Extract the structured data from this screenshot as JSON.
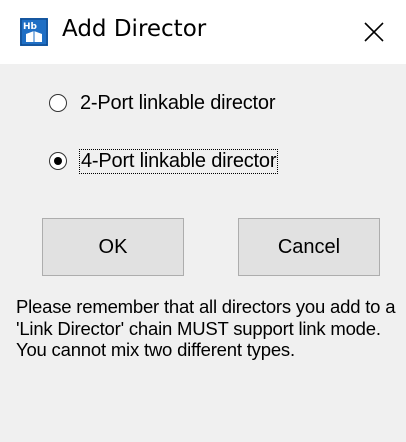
{
  "window": {
    "title": "Add Director",
    "icon": "hb-app-icon",
    "close_icon": "close-icon"
  },
  "options": [
    {
      "label": "2-Port linkable director",
      "selected": false
    },
    {
      "label": "4-Port linkable director",
      "selected": true
    }
  ],
  "buttons": {
    "ok_label": "OK",
    "cancel_label": "Cancel"
  },
  "note": "Please remember that all directors you add to a 'Link Director' chain MUST support link mode.  You cannot mix two different types.",
  "colors": {
    "window_bg": "#f0f0f0",
    "titlebar_bg": "#ffffff",
    "button_bg": "#e1e1e1",
    "icon_blue": "#1f6fc5"
  }
}
